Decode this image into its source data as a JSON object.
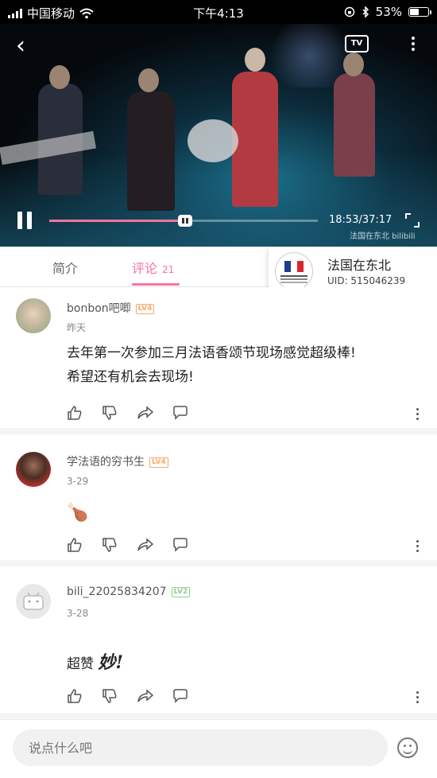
{
  "status_bar": {
    "carrier": "中国移动",
    "time": "下午4:13",
    "battery": "53%",
    "battery_level": 0.53
  },
  "video": {
    "current_time": "18:53",
    "total_time": "37:17",
    "time_display": "18:53/37:17",
    "progress": 0.506,
    "watermark": "法国在东北 bilibili",
    "tv_label": "TV"
  },
  "tabs": [
    {
      "label": "简介"
    },
    {
      "label": "评论",
      "count": "21"
    }
  ],
  "uploader": {
    "name": "法国在东北",
    "uid": "UID: 515046239"
  },
  "comments": [
    {
      "username": "bonbon吧唧",
      "level": "LV4",
      "date": "昨天",
      "lines": [
        "去年第一次参加三月法语香颂节现场感觉超级棒!",
        "希望还有机会去现场!"
      ]
    },
    {
      "username": "学法语的穷书生",
      "level": "LV4",
      "date": "3-29",
      "lines": [
        "🍗"
      ]
    },
    {
      "username": "bili_22025834207",
      "level": "LV2",
      "date": "3-28",
      "lines": [
        "超赞",
        "妙!"
      ]
    }
  ],
  "input": {
    "placeholder": "说点什么吧"
  },
  "colors": {
    "accent": "#fb7299",
    "level4": "#f7a96a",
    "level2": "#8fd18f"
  }
}
